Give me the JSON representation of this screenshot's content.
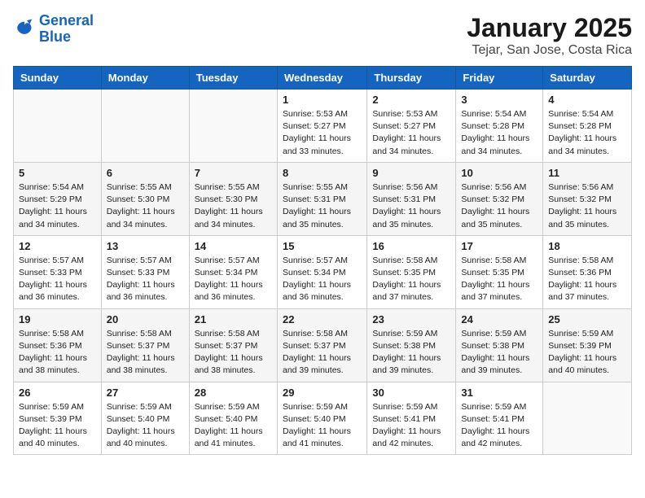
{
  "header": {
    "logo_line1": "General",
    "logo_line2": "Blue",
    "title": "January 2025",
    "subtitle": "Tejar, San Jose, Costa Rica"
  },
  "days_of_week": [
    "Sunday",
    "Monday",
    "Tuesday",
    "Wednesday",
    "Thursday",
    "Friday",
    "Saturday"
  ],
  "weeks": [
    [
      {
        "day": "",
        "info": ""
      },
      {
        "day": "",
        "info": ""
      },
      {
        "day": "",
        "info": ""
      },
      {
        "day": "1",
        "info": "Sunrise: 5:53 AM\nSunset: 5:27 PM\nDaylight: 11 hours\nand 33 minutes."
      },
      {
        "day": "2",
        "info": "Sunrise: 5:53 AM\nSunset: 5:27 PM\nDaylight: 11 hours\nand 34 minutes."
      },
      {
        "day": "3",
        "info": "Sunrise: 5:54 AM\nSunset: 5:28 PM\nDaylight: 11 hours\nand 34 minutes."
      },
      {
        "day": "4",
        "info": "Sunrise: 5:54 AM\nSunset: 5:28 PM\nDaylight: 11 hours\nand 34 minutes."
      }
    ],
    [
      {
        "day": "5",
        "info": "Sunrise: 5:54 AM\nSunset: 5:29 PM\nDaylight: 11 hours\nand 34 minutes."
      },
      {
        "day": "6",
        "info": "Sunrise: 5:55 AM\nSunset: 5:30 PM\nDaylight: 11 hours\nand 34 minutes."
      },
      {
        "day": "7",
        "info": "Sunrise: 5:55 AM\nSunset: 5:30 PM\nDaylight: 11 hours\nand 34 minutes."
      },
      {
        "day": "8",
        "info": "Sunrise: 5:55 AM\nSunset: 5:31 PM\nDaylight: 11 hours\nand 35 minutes."
      },
      {
        "day": "9",
        "info": "Sunrise: 5:56 AM\nSunset: 5:31 PM\nDaylight: 11 hours\nand 35 minutes."
      },
      {
        "day": "10",
        "info": "Sunrise: 5:56 AM\nSunset: 5:32 PM\nDaylight: 11 hours\nand 35 minutes."
      },
      {
        "day": "11",
        "info": "Sunrise: 5:56 AM\nSunset: 5:32 PM\nDaylight: 11 hours\nand 35 minutes."
      }
    ],
    [
      {
        "day": "12",
        "info": "Sunrise: 5:57 AM\nSunset: 5:33 PM\nDaylight: 11 hours\nand 36 minutes."
      },
      {
        "day": "13",
        "info": "Sunrise: 5:57 AM\nSunset: 5:33 PM\nDaylight: 11 hours\nand 36 minutes."
      },
      {
        "day": "14",
        "info": "Sunrise: 5:57 AM\nSunset: 5:34 PM\nDaylight: 11 hours\nand 36 minutes."
      },
      {
        "day": "15",
        "info": "Sunrise: 5:57 AM\nSunset: 5:34 PM\nDaylight: 11 hours\nand 36 minutes."
      },
      {
        "day": "16",
        "info": "Sunrise: 5:58 AM\nSunset: 5:35 PM\nDaylight: 11 hours\nand 37 minutes."
      },
      {
        "day": "17",
        "info": "Sunrise: 5:58 AM\nSunset: 5:35 PM\nDaylight: 11 hours\nand 37 minutes."
      },
      {
        "day": "18",
        "info": "Sunrise: 5:58 AM\nSunset: 5:36 PM\nDaylight: 11 hours\nand 37 minutes."
      }
    ],
    [
      {
        "day": "19",
        "info": "Sunrise: 5:58 AM\nSunset: 5:36 PM\nDaylight: 11 hours\nand 38 minutes."
      },
      {
        "day": "20",
        "info": "Sunrise: 5:58 AM\nSunset: 5:37 PM\nDaylight: 11 hours\nand 38 minutes."
      },
      {
        "day": "21",
        "info": "Sunrise: 5:58 AM\nSunset: 5:37 PM\nDaylight: 11 hours\nand 38 minutes."
      },
      {
        "day": "22",
        "info": "Sunrise: 5:58 AM\nSunset: 5:37 PM\nDaylight: 11 hours\nand 39 minutes."
      },
      {
        "day": "23",
        "info": "Sunrise: 5:59 AM\nSunset: 5:38 PM\nDaylight: 11 hours\nand 39 minutes."
      },
      {
        "day": "24",
        "info": "Sunrise: 5:59 AM\nSunset: 5:38 PM\nDaylight: 11 hours\nand 39 minutes."
      },
      {
        "day": "25",
        "info": "Sunrise: 5:59 AM\nSunset: 5:39 PM\nDaylight: 11 hours\nand 40 minutes."
      }
    ],
    [
      {
        "day": "26",
        "info": "Sunrise: 5:59 AM\nSunset: 5:39 PM\nDaylight: 11 hours\nand 40 minutes."
      },
      {
        "day": "27",
        "info": "Sunrise: 5:59 AM\nSunset: 5:40 PM\nDaylight: 11 hours\nand 40 minutes."
      },
      {
        "day": "28",
        "info": "Sunrise: 5:59 AM\nSunset: 5:40 PM\nDaylight: 11 hours\nand 41 minutes."
      },
      {
        "day": "29",
        "info": "Sunrise: 5:59 AM\nSunset: 5:40 PM\nDaylight: 11 hours\nand 41 minutes."
      },
      {
        "day": "30",
        "info": "Sunrise: 5:59 AM\nSunset: 5:41 PM\nDaylight: 11 hours\nand 42 minutes."
      },
      {
        "day": "31",
        "info": "Sunrise: 5:59 AM\nSunset: 5:41 PM\nDaylight: 11 hours\nand 42 minutes."
      },
      {
        "day": "",
        "info": ""
      }
    ]
  ]
}
